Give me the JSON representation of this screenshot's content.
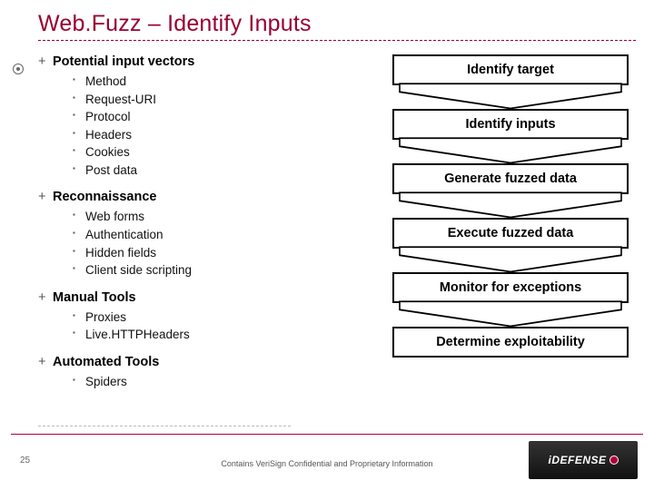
{
  "title": "Web.Fuzz – Identify Inputs",
  "groups": [
    {
      "heading": "Potential input vectors",
      "items": [
        "Method",
        "Request-URI",
        "Protocol",
        "Headers",
        "Cookies",
        "Post data"
      ]
    },
    {
      "heading": "Reconnaissance",
      "items": [
        "Web forms",
        "Authentication",
        "Hidden fields",
        "Client side scripting"
      ]
    },
    {
      "heading": "Manual Tools",
      "items": [
        "Proxies",
        "Live.HTTPHeaders"
      ]
    },
    {
      "heading": "Automated Tools",
      "items": [
        "Spiders"
      ]
    }
  ],
  "flow": [
    "Identify target",
    "Identify inputs",
    "Generate fuzzed data",
    "Execute fuzzed data",
    "Monitor for exceptions",
    "Determine exploitability"
  ],
  "footer": {
    "page": "25",
    "note": "Contains VeriSign Confidential and Proprietary Information",
    "logo": "iDEFENSE"
  }
}
